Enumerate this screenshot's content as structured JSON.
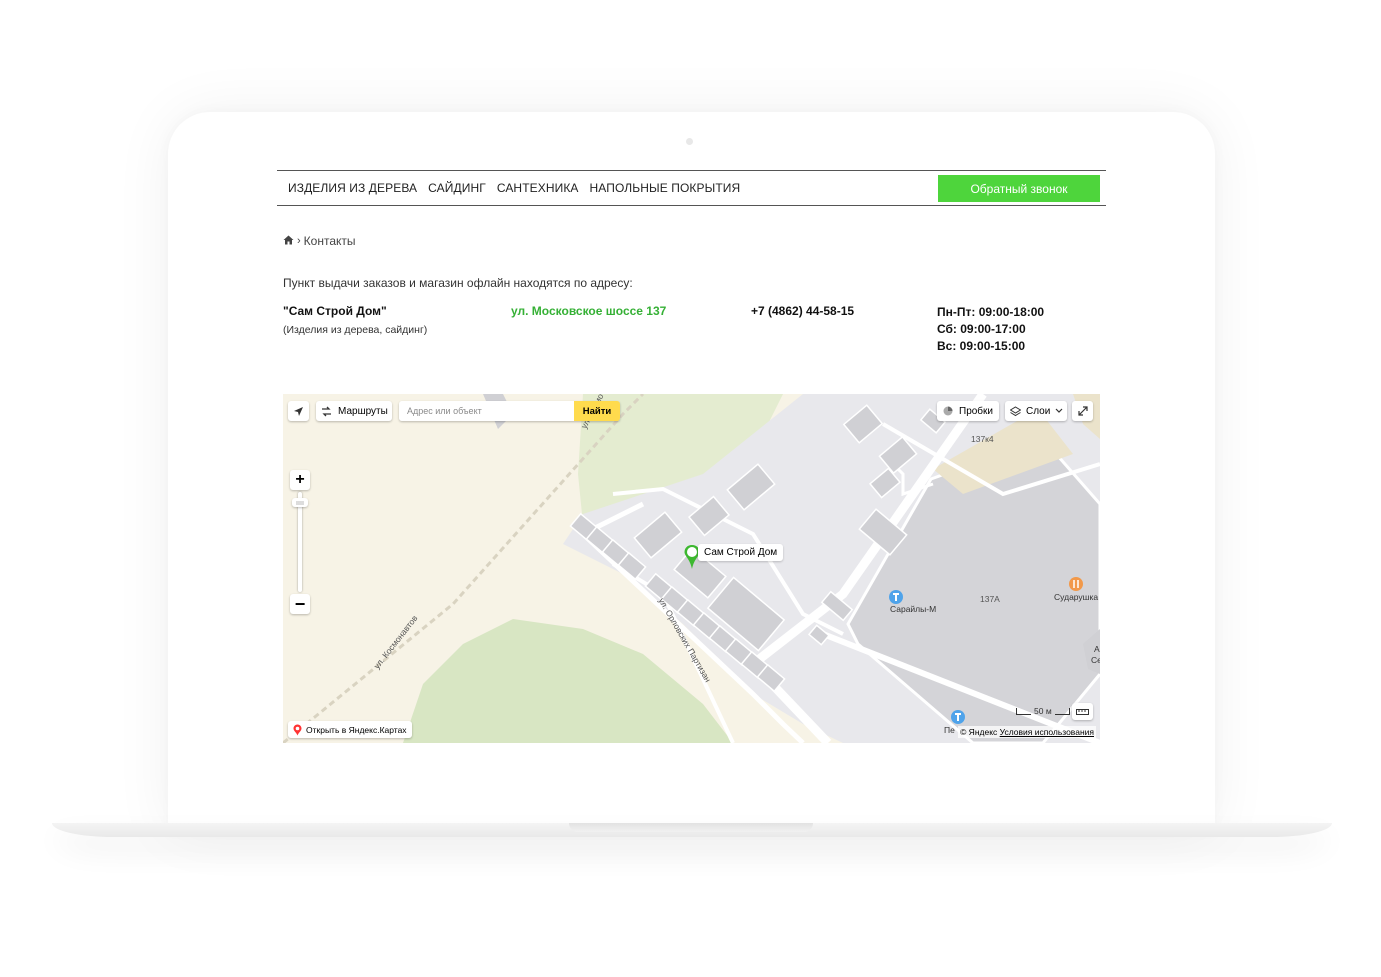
{
  "nav": {
    "links": [
      "ИЗДЕЛИЯ ИЗ ДЕРЕВА",
      "САЙДИНГ",
      "САНТЕХНИКА",
      "НАПОЛЬНЫЕ ПОКРЫТИЯ"
    ],
    "callback_label": "Обратный звонок",
    "accent_color": "#4ed53c"
  },
  "breadcrumb": {
    "current": "Контакты",
    "home_icon": "home-icon"
  },
  "intro": "Пункт выдачи заказов и магазин офлайн находятся по адресу:",
  "store": {
    "name": "\"Сам Строй Дом\"",
    "subtitle": "(Изделия из дерева, сайдинг)",
    "address": "ул. Московское шоссе 137",
    "phone": "+7 (4862) 44-58-15",
    "hours": [
      "Пн-Пт: 09:00-18:00",
      "Сб: 09:00-17:00",
      "Вс: 09:00-15:00"
    ],
    "address_color": "#35b035"
  },
  "map": {
    "routes_label": "Маршруты",
    "search_placeholder": "Адрес или объект",
    "search_button": "Найти",
    "traffic_label": "Пробки",
    "layers_label": "Слои",
    "placemark_label": "Сам Строй Дом",
    "open_in_maps": "Открыть в Яндекс.Картах",
    "copyright": "© Яндекс",
    "terms": "Условия использования",
    "scale_label": "50 м",
    "labels": {
      "street_1": "ул. Космонавтов",
      "street_2": "ул. Орловских Партизан",
      "street_3": "ул. Космо",
      "building_1": "137к4",
      "building_2": "137А",
      "poi_1": "Сарайлы-М",
      "poi_2": "Сударушка",
      "poi_3": "Пе",
      "poi_4": "А",
      "poi_5": "Се"
    }
  }
}
